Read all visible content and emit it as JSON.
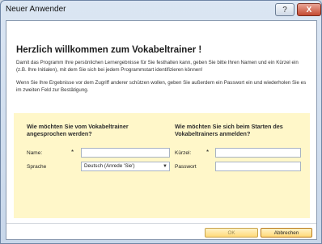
{
  "window": {
    "title": "Neuer Anwender"
  },
  "controls": {
    "help_label": "?",
    "close_label": "X"
  },
  "content": {
    "heading": "Herzlich willkommen zum Vokabeltrainer !",
    "paragraph1": "Damit das Programm Ihre persönlichen Lernergebnisse für Sie festhalten kann, geben Sie bitte Ihren Namen und ein Kürzel ein (z.B. Ihre Initialen), mit dem Sie sich bei jedem Programmstart identifizieren können!",
    "paragraph2": "Wenn Sie Ihre Ergebnisse vor dem Zugriff anderer schützen wollen, geben Sie außerdem ein Passwort ein und wiederholen Sie es im zweiten Feld zur Bestätigung."
  },
  "panel": {
    "left_heading": "Wie möchten Sie vom Vokabeltrainer angesprochen werden?",
    "right_heading": "Wie möchten Sie sich beim Starten des Vokabeltrainers anmelden?",
    "name_label": "Name:",
    "language_label": "Sprache",
    "language_value": "Deutsch (Anrede 'Sie')",
    "short_label": "Kürzel:",
    "password_label": "Passwort",
    "required_marker": "*"
  },
  "footer": {
    "ok_label": "OK",
    "cancel_label": "Abbrechen"
  }
}
